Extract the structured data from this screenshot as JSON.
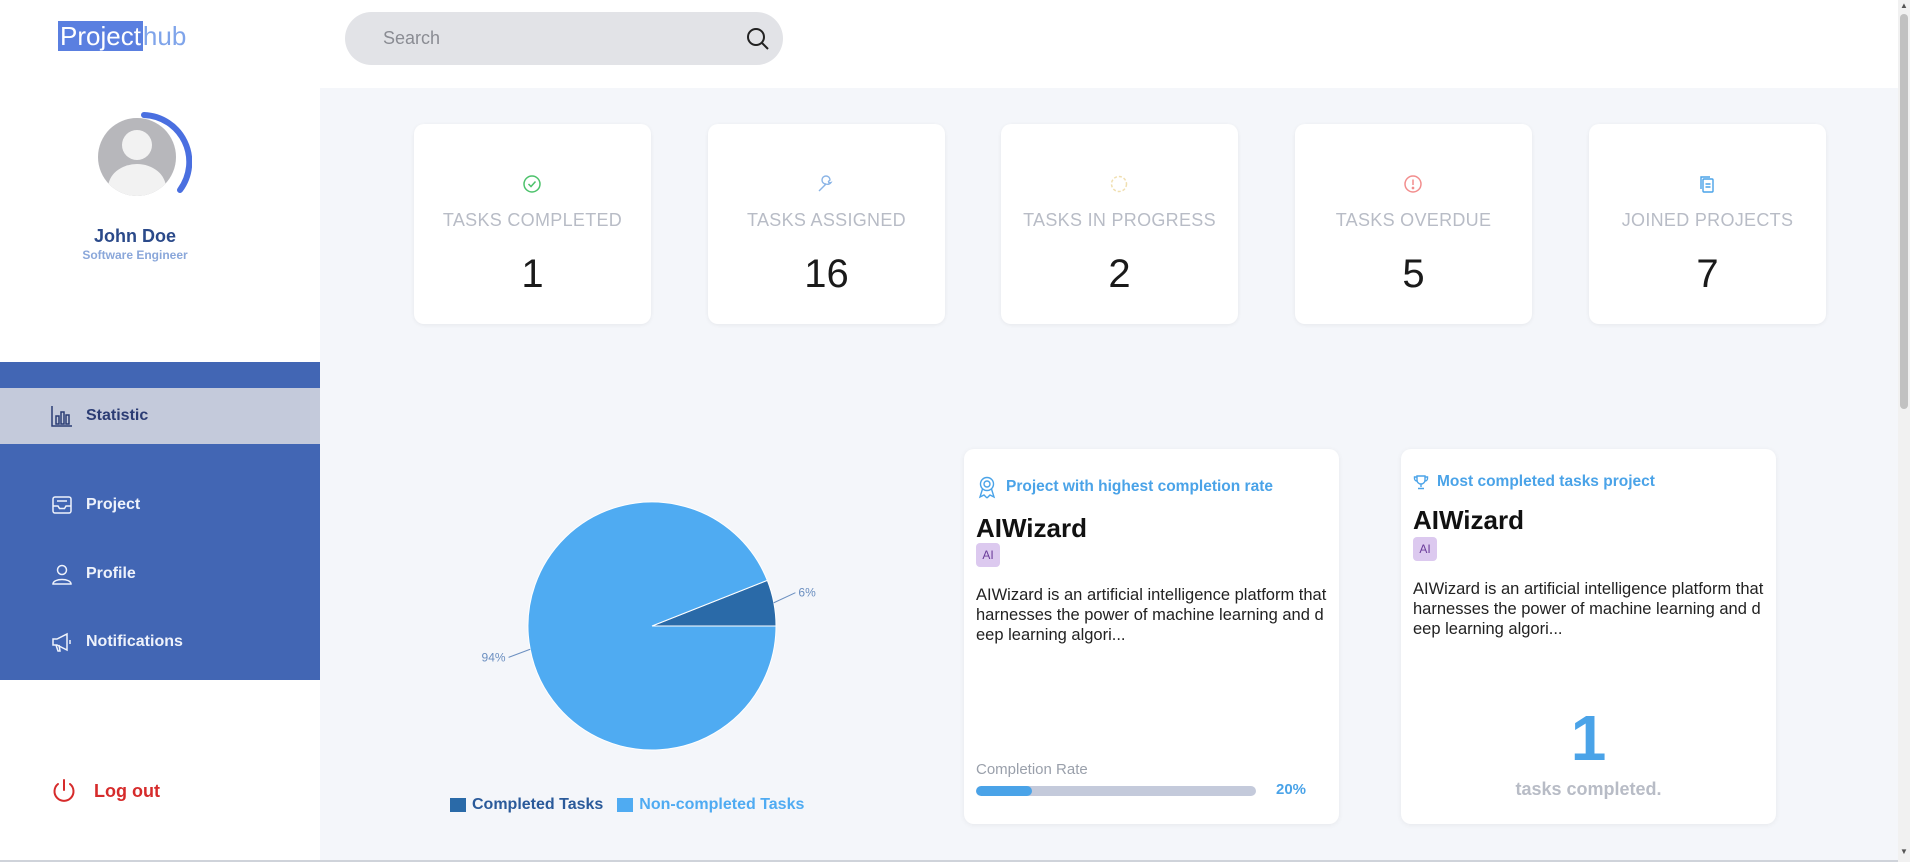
{
  "brand": {
    "part1": "Project",
    "part2": "hub"
  },
  "user": {
    "name": "John Doe",
    "role": "Software Engineer"
  },
  "search": {
    "placeholder": "Search"
  },
  "nav": {
    "items": [
      {
        "label": "Statistic",
        "icon": "bar-chart-icon",
        "active": true
      },
      {
        "label": "Project",
        "icon": "inbox-icon",
        "active": false
      },
      {
        "label": "Profile",
        "icon": "user-icon",
        "active": false
      },
      {
        "label": "Notifications",
        "icon": "megaphone-icon",
        "active": false
      }
    ],
    "logout": "Log out"
  },
  "stats": [
    {
      "label": "TASKS COMPLETED",
      "value": "1",
      "icon": "check-circle-icon",
      "color": "#4cc26b"
    },
    {
      "label": "TASKS ASSIGNED",
      "value": "16",
      "icon": "wrench-icon",
      "color": "#8ab4e6"
    },
    {
      "label": "TASKS IN PROGRESS",
      "value": "2",
      "icon": "spinner-icon",
      "color": "#f0dfb0"
    },
    {
      "label": "TASKS OVERDUE",
      "value": "5",
      "icon": "alert-circle-icon",
      "color": "#f28d8d"
    },
    {
      "label": "JOINED PROJECTS",
      "value": "7",
      "icon": "copy-icon",
      "color": "#4aa3e8"
    }
  ],
  "chart_data": {
    "type": "pie",
    "title": "",
    "categories": [
      "Completed Tasks",
      "Non-completed Tasks"
    ],
    "values": [
      6,
      94
    ],
    "data_labels": [
      "6%",
      "94%"
    ],
    "colors": [
      "#2a6aa8",
      "#4fabf2"
    ],
    "legend_position": "bottom",
    "legend": [
      "Completed Tasks",
      "Non-completed Tasks"
    ]
  },
  "cards": {
    "highest_rate": {
      "heading": "Project with highest completion rate",
      "title": "AIWizard",
      "tag": "AI",
      "description": "AIWizard is an artificial intelligence platform that harnesses the power of machine learning and deep learning algori...",
      "rate_label": "Completion Rate",
      "rate_value": 0.2,
      "rate_text": "20%"
    },
    "most_completed": {
      "heading": "Most completed tasks project",
      "title": "AIWizard",
      "tag": "AI",
      "description": "AIWizard is an artificial intelligence platform that harnesses the power of machine learning and deep learning algori...",
      "count": "1",
      "count_caption": "tasks completed."
    }
  },
  "colors": {
    "accent": "#4aa3e8",
    "nav_bg": "#4266b4",
    "danger": "#d62b2b"
  }
}
